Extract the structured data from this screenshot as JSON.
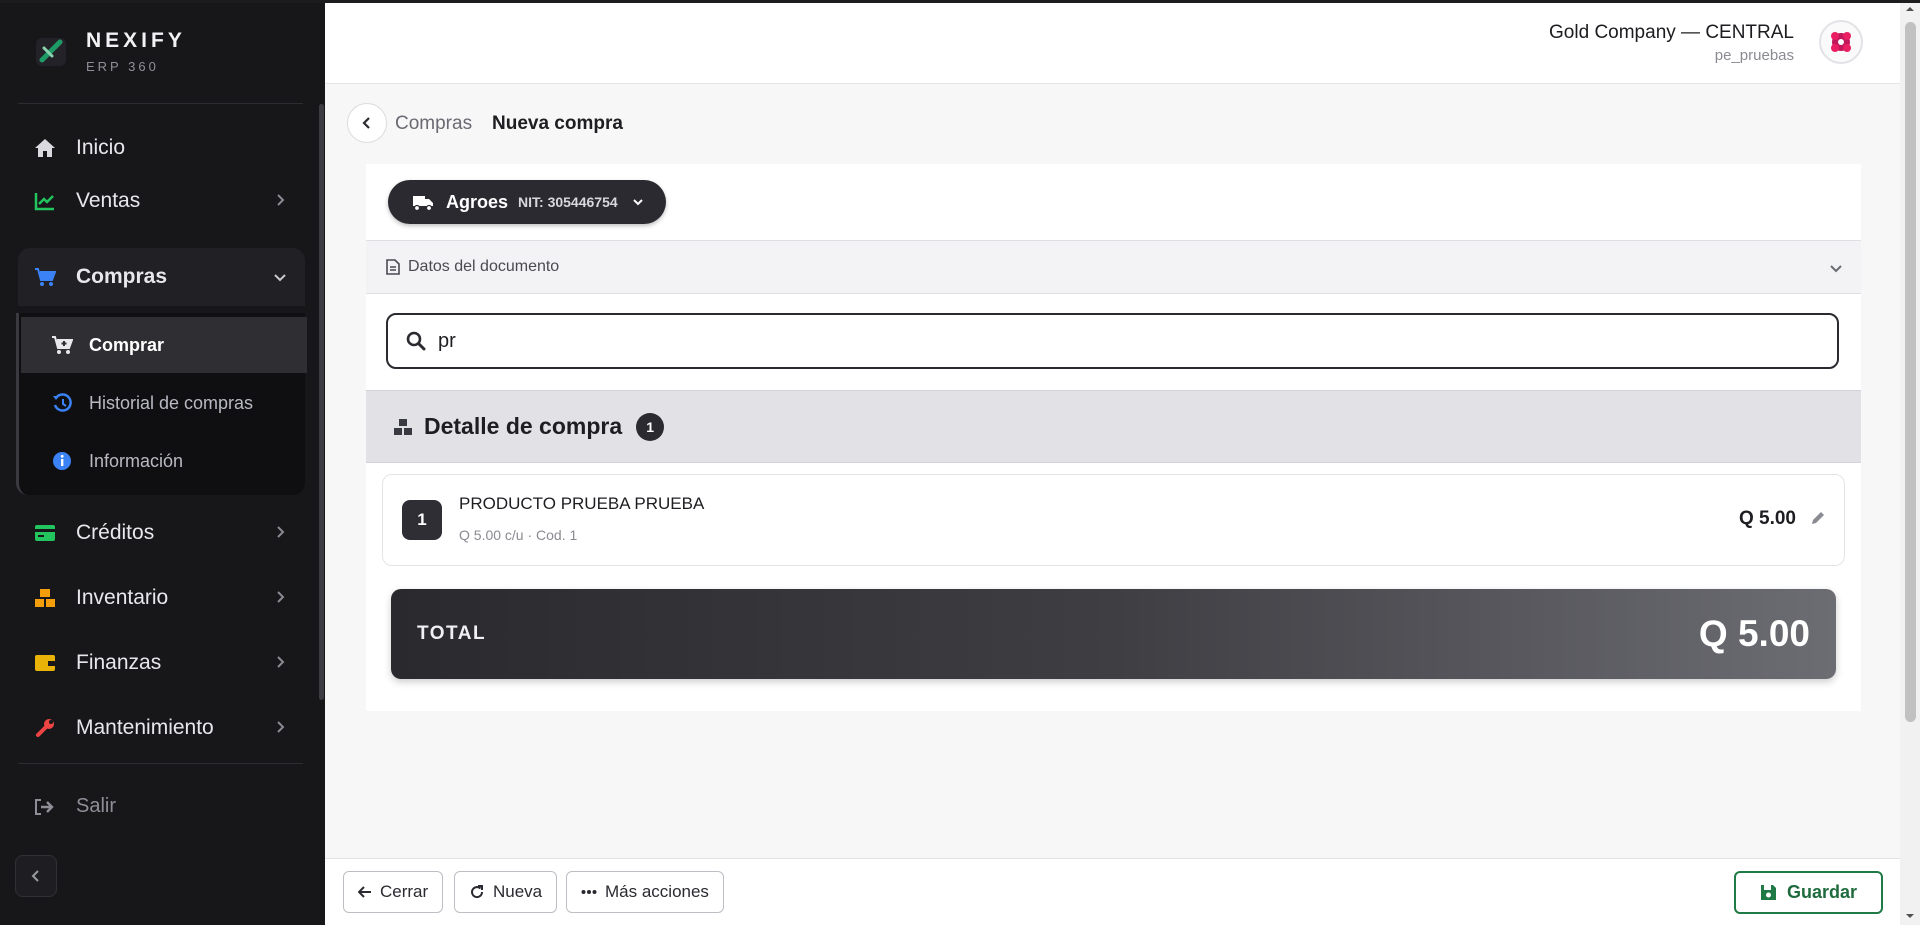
{
  "brand": {
    "name": "NEXIFY",
    "sub": "ERP 360"
  },
  "sidebar": {
    "items": [
      {
        "label": "Inicio"
      },
      {
        "label": "Ventas"
      },
      {
        "label": "Compras"
      },
      {
        "label": "Créditos"
      },
      {
        "label": "Inventario"
      },
      {
        "label": "Finanzas"
      },
      {
        "label": "Mantenimiento"
      }
    ],
    "subitems": [
      {
        "label": "Comprar"
      },
      {
        "label": "Historial de compras"
      },
      {
        "label": "Información"
      }
    ],
    "logout": "Salir"
  },
  "topbar": {
    "company": "Gold Company — CENTRAL",
    "user": "pe_pruebas"
  },
  "breadcrumb": {
    "parent": "Compras",
    "current": "Nueva compra"
  },
  "supplier": {
    "name": "Agroes",
    "nit": "NIT: 305446754"
  },
  "document": {
    "label": "Datos del documento"
  },
  "search": {
    "value": "pr"
  },
  "detail": {
    "title": "Detalle de compra",
    "count": "1",
    "items": [
      {
        "qty": "1",
        "name": "PRODUCTO PRUEBA PRUEBA",
        "meta": "Q 5.00 c/u · Cod. 1",
        "price": "Q 5.00"
      }
    ]
  },
  "total": {
    "label": "TOTAL",
    "value": "Q 5.00"
  },
  "footer": {
    "close": "Cerrar",
    "new": "Nueva",
    "more": "Más acciones",
    "save": "Guardar"
  },
  "colors": {
    "sidebar_bg": "#17171a",
    "accent_dark": "#2a2a30",
    "save_green": "#1f7a45",
    "ventas_green": "#22c55e",
    "compras_blue": "#3b82f6",
    "inventario_orange": "#f59e0b",
    "finanzas_yellow": "#eab308",
    "mantenimiento_red": "#ef4444"
  }
}
